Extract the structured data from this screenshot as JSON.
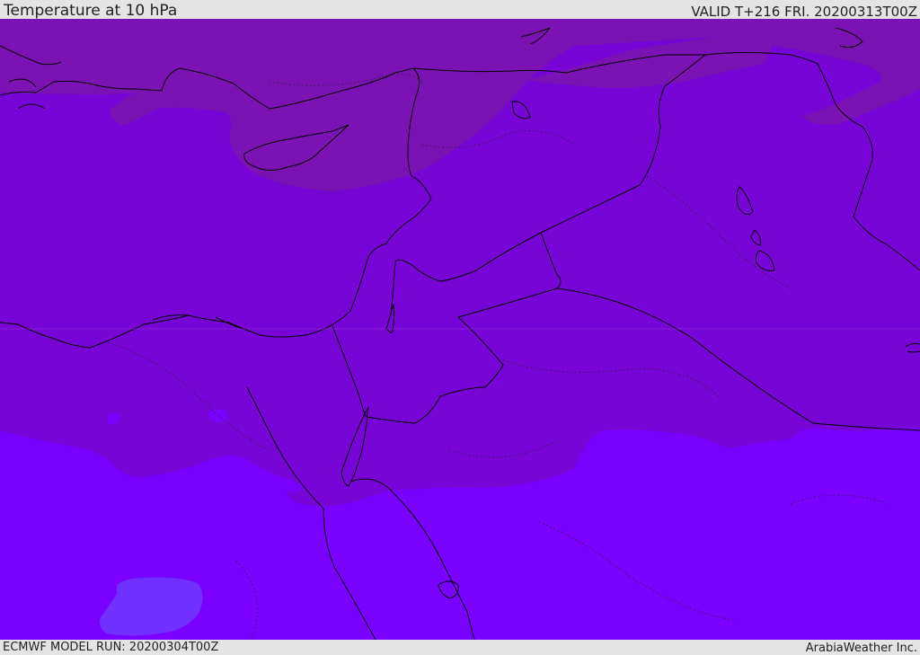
{
  "header": {
    "title": "Temperature at 10 hPa",
    "valid": "VALID T+216 FRI. 20200313T00Z"
  },
  "footer": {
    "model_run": "ECMWF MODEL RUN: 20200304T00Z",
    "credit": "ArabiaWeather Inc."
  },
  "map": {
    "field_colors": {
      "cold_band": "#7b12b4",
      "mid_band": "#7904d6",
      "warm_band": "#7a00ff",
      "warmest_patch": "#7030ff"
    },
    "coastline_color": "#000000"
  }
}
